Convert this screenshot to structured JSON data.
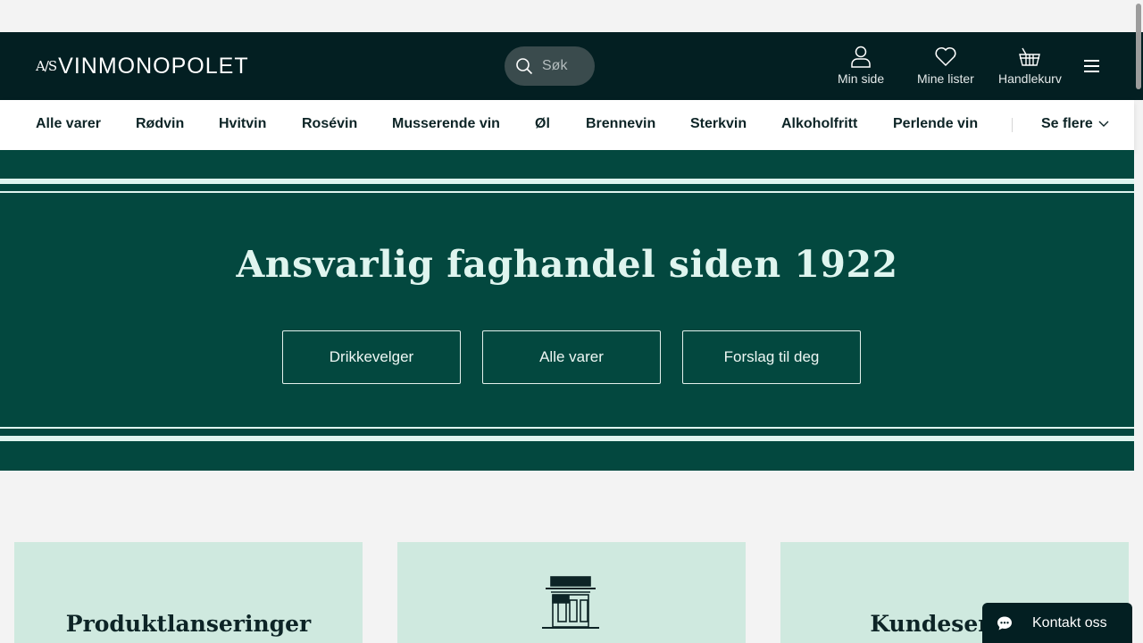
{
  "header": {
    "logo_prefix": "A/S",
    "logo_name": "VINMONOPOLET",
    "search_placeholder": "Søk",
    "links": [
      {
        "label": "Min side",
        "icon": "user-icon"
      },
      {
        "label": "Mine lister",
        "icon": "heart-icon"
      },
      {
        "label": "Handlekurv",
        "icon": "basket-icon"
      }
    ],
    "menu_icon": "hamburger-menu-icon"
  },
  "nav": {
    "items": [
      "Alle varer",
      "Rødvin",
      "Hvitvin",
      "Rosévin",
      "Musserende vin",
      "Øl",
      "Brennevin",
      "Sterkvin",
      "Alkoholfritt",
      "Perlende vin"
    ],
    "more_label": "Se flere"
  },
  "hero": {
    "title": "Ansvarlig faghandel siden 1922",
    "buttons": [
      "Drikkevelger",
      "Alle varer",
      "Forslag til deg"
    ]
  },
  "cards": [
    {
      "title": "Produktlanseringer"
    },
    {
      "title": "",
      "icon": "store-icon"
    },
    {
      "title": "Kundeservice"
    }
  ],
  "chat": {
    "label": "Kontakt oss",
    "icon": "chat-bubble-icon"
  },
  "colors": {
    "header_bg": "#031f22",
    "hero_bg": "#03483f",
    "card_bg": "#cfe9df",
    "text_dark": "#0d2426"
  }
}
